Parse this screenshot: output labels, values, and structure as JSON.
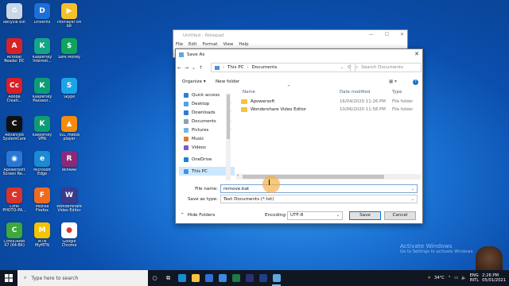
{
  "desktop_icons": [
    {
      "label": "Recycle Bin",
      "color": "#c9d7e6",
      "glyph": "♻"
    },
    {
      "label": "Driverfix",
      "color": "#1c6fd6",
      "glyph": "D"
    },
    {
      "label": "PotPlayer 64\nbit",
      "color": "#f4c12b",
      "glyph": "▶"
    },
    {
      "label": "Acrobat\nReader DC",
      "color": "#d7222a",
      "glyph": "A"
    },
    {
      "label": "Kaspersky\nInternet...",
      "color": "#12a589",
      "glyph": "K"
    },
    {
      "label": "Safe Money",
      "color": "#0fa35f",
      "glyph": "$"
    },
    {
      "label": "Adobe\nCreati...",
      "color": "#da1f26",
      "glyph": "Cc"
    },
    {
      "label": "Kaspersky\nPasswor...",
      "color": "#0d9c78",
      "glyph": "K"
    },
    {
      "label": "Skype",
      "color": "#1ba3e8",
      "glyph": "S"
    },
    {
      "label": "Advanced\nSystemCare",
      "color": "#101010",
      "glyph": "C"
    },
    {
      "label": "Kaspersky\nVPN",
      "color": "#0e9c76",
      "glyph": "K"
    },
    {
      "label": "VLC media\nplayer",
      "color": "#f48b0b",
      "glyph": "▲"
    },
    {
      "label": "Apowersoft\nScreen Re...",
      "color": "#2a78d6",
      "glyph": "◉"
    },
    {
      "label": "Microsoft\nEdge",
      "color": "#1b8bd4",
      "glyph": "e"
    },
    {
      "label": "WinRAR",
      "color": "#8b2a7a",
      "glyph": "R"
    },
    {
      "label": "Corel\nPHOTO-PA...",
      "color": "#d9342b",
      "glyph": "C"
    },
    {
      "label": "Mozilla\nFirefox",
      "color": "#ef6b1f",
      "glyph": "F"
    },
    {
      "label": "Wondershare\nVideo Editor",
      "color": "#3a3a8f",
      "glyph": "W"
    },
    {
      "label": "CorelDRAW\nX7 (64-Bit)",
      "color": "#3ea83a",
      "glyph": "C"
    },
    {
      "label": "MTN\nMyMTN",
      "color": "#f5c400",
      "glyph": "M"
    },
    {
      "label": "Google\nChrome",
      "color": "#ffffff",
      "glyph": "●"
    }
  ],
  "notepad": {
    "title": "Untitled - Notepad",
    "menu": [
      "File",
      "Edit",
      "Format",
      "View",
      "Help"
    ],
    "controls": [
      "—",
      "☐",
      "✕"
    ]
  },
  "dialog": {
    "title": "Save As",
    "close": "✕",
    "path": [
      "This PC",
      "Documents"
    ],
    "search_placeholder": "Search Documents",
    "organize": "Organize ▾",
    "new_folder": "New folder",
    "view_glyph": "▦ ▾",
    "help_glyph": "?",
    "nav_items": [
      {
        "label": "Quick access",
        "color": "#2f7fd6",
        "pinned": false,
        "selected": false
      },
      {
        "label": "Desktop",
        "color": "#4fa3e8",
        "pinned": true,
        "selected": false
      },
      {
        "label": "Downloads",
        "color": "#2e7bd6",
        "pinned": true,
        "selected": false
      },
      {
        "label": "Documents",
        "color": "#8aa0b8",
        "pinned": true,
        "selected": false
      },
      {
        "label": "Pictures",
        "color": "#6fb4e6",
        "pinned": true,
        "selected": false
      },
      {
        "label": "Music",
        "color": "#e07a2a",
        "pinned": false,
        "selected": false
      },
      {
        "label": "Videos",
        "color": "#7a5acb",
        "pinned": false,
        "selected": false
      },
      {
        "label": "OneDrive",
        "color": "#1b80d6",
        "pinned": false,
        "selected": false
      },
      {
        "label": "This PC",
        "color": "#4a90d9",
        "pinned": false,
        "selected": true
      }
    ],
    "pin_glyph": "📌",
    "columns": [
      "Name",
      "Date modified",
      "Type"
    ],
    "files": [
      {
        "name": "Apowersoft",
        "date": "16/04/2020 11:26 PM",
        "type": "File folder"
      },
      {
        "name": "Wondershare Video Editor",
        "date": "10/06/2020 11:58 PM",
        "type": "File folder"
      }
    ],
    "file_name_label": "File name:",
    "file_name_value": "remove.bat",
    "save_type_label": "Save as type:",
    "save_type_value": "Text Documents (*.txt)",
    "hide_folders": "Hide Folders",
    "encoding_label": "Encoding:",
    "encoding_value": "UTF-8",
    "save_button": "Save",
    "cancel_button": "Cancel"
  },
  "watermark": {
    "line1": "Activate Windows",
    "line2": "Go to Settings to activate Windows."
  },
  "taskbar": {
    "search_placeholder": "Type here to search",
    "apps": [
      {
        "name": "cortana",
        "glyph": "○",
        "color": ""
      },
      {
        "name": "task-view",
        "glyph": "⧉",
        "color": ""
      },
      {
        "name": "edge",
        "glyph": "",
        "color": "#1b8bd4"
      },
      {
        "name": "file-explorer",
        "glyph": "",
        "color": "#f5c243"
      },
      {
        "name": "store",
        "glyph": "",
        "color": "#2f6fd6"
      },
      {
        "name": "mail",
        "glyph": "",
        "color": "#3c8be0"
      },
      {
        "name": "excel",
        "glyph": "",
        "color": "#1f7a45"
      },
      {
        "name": "photoshop",
        "glyph": "",
        "color": "#2c2f77"
      },
      {
        "name": "photoshop-2",
        "glyph": "",
        "color": "#1e3f8a"
      },
      {
        "name": "notepad",
        "glyph": "",
        "color": "#5fa7e0"
      }
    ],
    "weather": "34°C",
    "language": "ENG\nINTL",
    "time": "2:26 PM",
    "date": "05/01/2021"
  }
}
